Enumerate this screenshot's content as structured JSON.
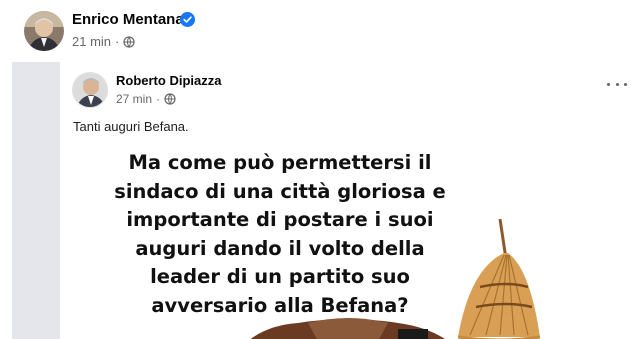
{
  "post": {
    "author": "Enrico Mentana",
    "time": "21 min",
    "separator": "·",
    "verified": true
  },
  "shared_post": {
    "author": "Roberto Dipiazza",
    "time": "27 min",
    "separator": "·",
    "text": "Tanti auguri Befana.",
    "image_caption": "Ma come può permettersi il sindaco di una città gloriosa e importante di postare i suoi auguri dando il volto della leader di un partito suo avversario alla Befana?"
  },
  "colors": {
    "verified_badge": "#1877f2",
    "meta_text": "#65676b",
    "frame_gray": "#e4e6eb"
  },
  "icons": {
    "verified": "verified-badge-icon",
    "audience": "globe-icon",
    "menu": "more-options-icon"
  }
}
